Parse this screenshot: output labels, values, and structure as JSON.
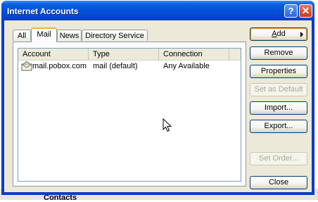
{
  "window": {
    "title": "Internet Accounts",
    "help_glyph": "?",
    "close_glyph": "✕"
  },
  "background": {
    "partial_text": "Contacts"
  },
  "tabs": [
    {
      "label": "All",
      "active": false
    },
    {
      "label": "Mail",
      "active": true
    },
    {
      "label": "News",
      "active": false
    },
    {
      "label": "Directory Service",
      "active": false
    }
  ],
  "list": {
    "columns": [
      "Account",
      "Type",
      "Connection"
    ],
    "rows": [
      {
        "account": "mail.pobox.com",
        "type": "mail (default)",
        "connection": "Any Available",
        "icon": "mail-account-icon"
      }
    ]
  },
  "buttons": {
    "add": {
      "label": "Add",
      "mnemonic": "A",
      "rest": "dd",
      "enabled": true
    },
    "remove": {
      "label": "Remove",
      "enabled": true
    },
    "properties": {
      "label": "Properties",
      "enabled": true
    },
    "set_default": {
      "label": "Set as Default",
      "enabled": false
    },
    "import": {
      "label": "Import...",
      "enabled": true
    },
    "export": {
      "label": "Export...",
      "enabled": true
    },
    "set_order": {
      "label": "Set Order...",
      "enabled": false
    },
    "close": {
      "label": "Close",
      "enabled": true
    }
  },
  "colors": {
    "titlebar": "#0550d8",
    "dialog_face": "#ece9d8",
    "focus_accent": "#f9b03c",
    "close_button": "#c83a18"
  }
}
